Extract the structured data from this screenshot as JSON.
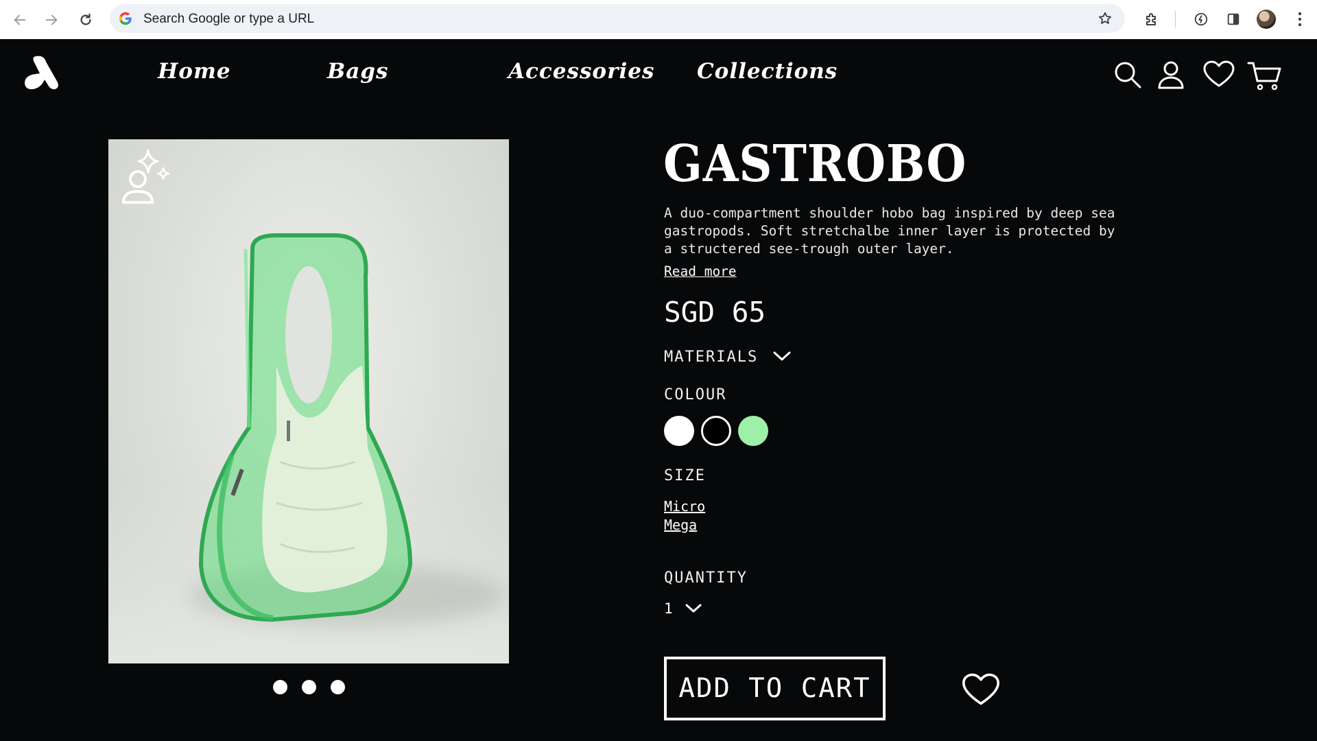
{
  "browser": {
    "omnibox_placeholder": "Search Google or type a URL",
    "icons": [
      "back-arrow-icon",
      "forward-arrow-icon",
      "reload-icon",
      "google-icon",
      "bookmark-star-icon",
      "extensions-icon",
      "performance-icon",
      "side-panel-icon",
      "profile-avatar",
      "more-menu-icon"
    ]
  },
  "header": {
    "logo": "brand-logo",
    "nav": [
      "Home",
      "Bags",
      "Accessories",
      "Collections"
    ],
    "icons": [
      "search-icon",
      "account-icon",
      "wishlist-heart-icon",
      "cart-icon"
    ]
  },
  "gallery": {
    "badge_icon": "ai-sparkle-person-icon",
    "slide_count": 3,
    "accent_color": "#5fdc7c"
  },
  "product": {
    "title": "GASTROBO",
    "description_lines": [
      "A duo-compartment shoulder hobo bag inspired by deep sea",
      "gastropods. Soft stretchalbe inner layer is protected by",
      "a structered see-trough outer layer."
    ],
    "read_more": "Read more",
    "price": "SGD 65",
    "materials_label": "MATERIALS",
    "colour_label": "COLOUR",
    "colours": [
      "#ffffff",
      "#000000",
      "#9ef0a8"
    ],
    "size_label": "SIZE",
    "sizes": [
      "Micro",
      "Mega"
    ],
    "quantity_label": "QUANTITY",
    "quantity_value": "1",
    "add_to_cart": "ADD TO CART"
  }
}
